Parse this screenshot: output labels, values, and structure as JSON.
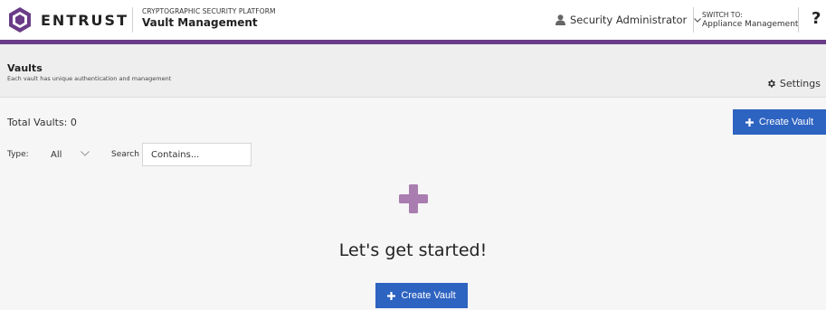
{
  "header": {
    "logo_text": "ENTRUST",
    "product_sub": "CRYPTOGRAPHIC SECURITY PLATFORM",
    "product_name": "Vault Management",
    "user_name": "Security Administrator",
    "switch_label": "SWITCH TO:",
    "switch_target": "Appliance Management",
    "help_label": "?"
  },
  "band": {
    "title": "Vaults",
    "description": "Each vault has unique authentication and management",
    "settings_label": "Settings"
  },
  "content": {
    "total_label": "Total Vaults: 0",
    "create_label": "Create Vault",
    "type_label": "Type:",
    "type_value": "All",
    "search_label": "Search",
    "search_placeholder": "Contains...",
    "empty_title": "Let's get started!",
    "empty_create_label": "Create Vault"
  },
  "colors": {
    "brand_purple": "#6a3c87",
    "accent_blue": "#2d63c1",
    "plus_mauve": "#a97db0"
  }
}
